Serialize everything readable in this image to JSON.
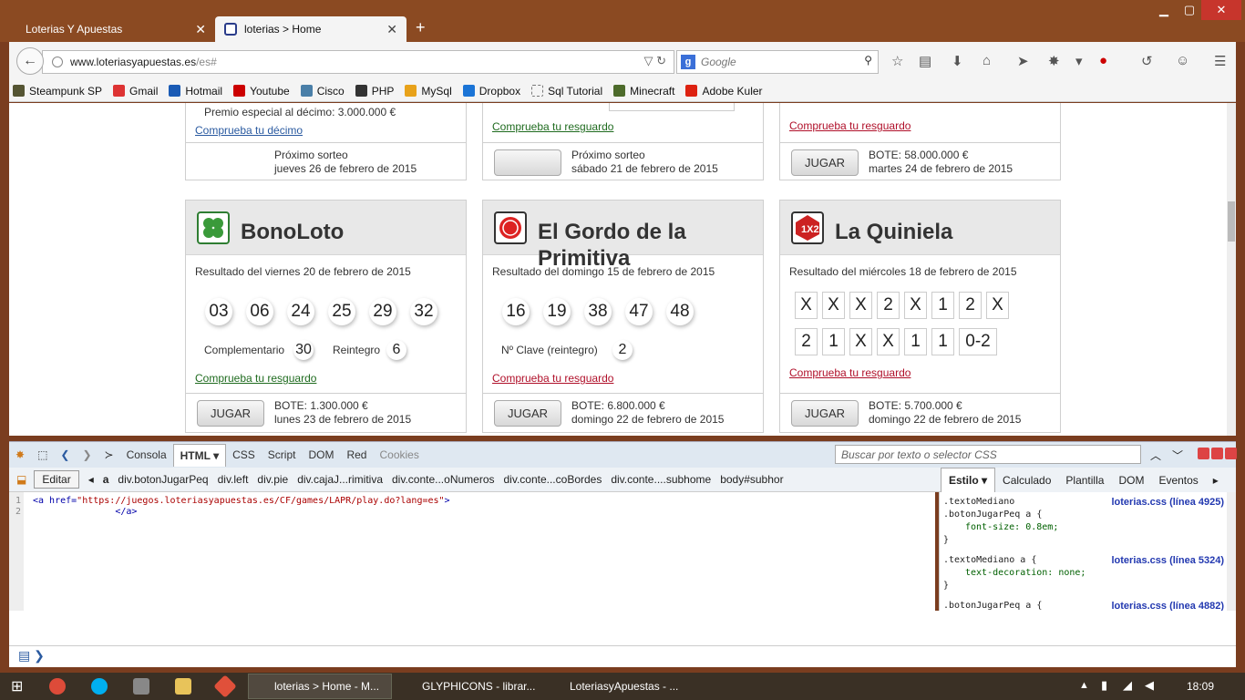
{
  "browser": {
    "tabs": [
      {
        "title": "Loterias Y Apuestas"
      },
      {
        "title": "loterias > Home"
      }
    ],
    "url": "www.loteriasyapuestas.es",
    "url_suffix": "/es#",
    "search_placeholder": "Google",
    "bookmarks": [
      "Steampunk SP",
      "Gmail",
      "Hotmail",
      "Youtube",
      "Cisco",
      "PHP",
      "MySql",
      "Dropbox",
      "Sql Tutorial",
      "Minecraft",
      "Adobe Kuler"
    ]
  },
  "page": {
    "top_cards": [
      {
        "extra_line": "Premio especial al décimo: 3.000.000 €",
        "link": "Comprueba tu décimo",
        "foot_line1": "Próximo sorteo",
        "foot_line2": "jueves 26 de febrero de 2015"
      },
      {
        "link": "Comprueba tu resguardo",
        "foot_line1": "Próximo sorteo",
        "foot_line2": "sábado 21 de febrero de 2015"
      },
      {
        "link": "Comprueba tu resguardo",
        "button": "JUGAR",
        "foot_line1": "BOTE:  58.000.000 €",
        "foot_line2": "martes 24 de febrero de 2015"
      }
    ],
    "bonoloto": {
      "title": "BonoLoto",
      "result_date": "Resultado del  viernes 20 de febrero de 2015",
      "numbers": [
        "03",
        "06",
        "24",
        "25",
        "29",
        "32"
      ],
      "complementario_label": "Complementario",
      "complementario": "30",
      "reintegro_label": "Reintegro",
      "reintegro": "6",
      "link": "Comprueba tu resguardo",
      "button": "JUGAR",
      "bote": "BOTE:  1.300.000 €",
      "next_date": "lunes 23 de febrero de 2015"
    },
    "gordo": {
      "title": "El Gordo de la Primitiva",
      "result_date": "Resultado del  domingo 15 de febrero de 2015",
      "numbers": [
        "16",
        "19",
        "38",
        "47",
        "48"
      ],
      "clave_label": "Nº Clave (reintegro)",
      "clave": "2",
      "link": "Comprueba tu resguardo",
      "button": "JUGAR",
      "bote": "BOTE:  6.800.000 €",
      "next_date": "domingo 22 de febrero de 2015"
    },
    "quiniela": {
      "title": "La Quiniela",
      "result_date": "Resultado del  miércoles 18 de febrero de 2015",
      "row1": [
        "X",
        "X",
        "X",
        "2",
        "X",
        "1",
        "2",
        "X"
      ],
      "row2": [
        "2",
        "1",
        "X",
        "X",
        "1",
        "1",
        "0-2"
      ],
      "link": "Comprueba tu resguardo",
      "button": "JUGAR",
      "bote": "BOTE:  5.700.000 €",
      "next_date": "domingo 22 de febrero de 2015"
    }
  },
  "firebug": {
    "tabs": [
      "Consola",
      "HTML",
      "CSS",
      "Script",
      "DOM",
      "Red",
      "Cookies"
    ],
    "search_placeholder": "Buscar por texto o selector CSS",
    "edit_label": "Editar",
    "breadcrumbs": [
      "a",
      "div.botonJugarPeq",
      "div.left",
      "div.pie",
      "div.cajaJ...rimitiva",
      "div.conte...oNumeros",
      "div.conte...coBordes",
      "div.conte....subhome",
      "body#subhor"
    ],
    "side_tabs": [
      "Estilo",
      "Calculado",
      "Plantilla",
      "DOM",
      "Eventos"
    ],
    "code_line1_tag": "<a href=",
    "code_line1_val": "\"https://juegos.loteriasyapuestas.es/CF/games/LAPR/play.do?lang=es\"",
    "code_line1_end": ">",
    "code_line2": "</a>",
    "css_rules": [
      {
        "selector": ".textoMediano",
        "selector2": ".botonJugarPeq a {",
        "prop": "font-size: 0.8em;",
        "close": "}",
        "source": "loterias.css (línea 4925)"
      },
      {
        "selector": ".textoMediano a {",
        "prop": "text-decoration: none;",
        "close": "}",
        "source": "loterias.css (línea 5324)"
      },
      {
        "selector": ".botonJugarPeq a {",
        "source": "loterias.css (línea 4882)"
      }
    ]
  },
  "taskbar": {
    "tasks": [
      "loterias > Home - M...",
      "GLYPHICONS - librar...",
      "LoteriasyApuestas - ..."
    ],
    "clock": "18:09"
  }
}
